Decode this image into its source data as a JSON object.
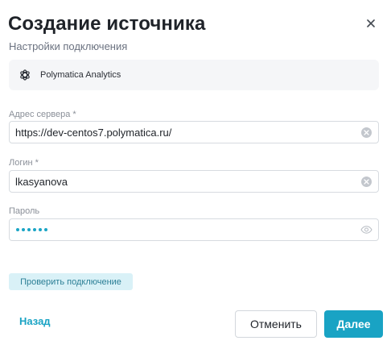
{
  "dialog": {
    "title": "Создание источника",
    "subtitle": "Настройки подключения"
  },
  "source": {
    "name": "Polymatica Analytics",
    "icon": "polymatica-logo-icon"
  },
  "fields": {
    "server": {
      "label": "Адрес сервера *",
      "value": "https://dev-centos7.polymatica.ru/"
    },
    "login": {
      "label": "Логин *",
      "value": "lkasyanova"
    },
    "password": {
      "label": "Пароль",
      "masked_length": 6
    }
  },
  "buttons": {
    "check": "Проверить подключение",
    "back": "Назад",
    "cancel": "Отменить",
    "next": "Далее"
  },
  "colors": {
    "accent": "#19a3c4",
    "accent_light": "#d9f1f7"
  }
}
